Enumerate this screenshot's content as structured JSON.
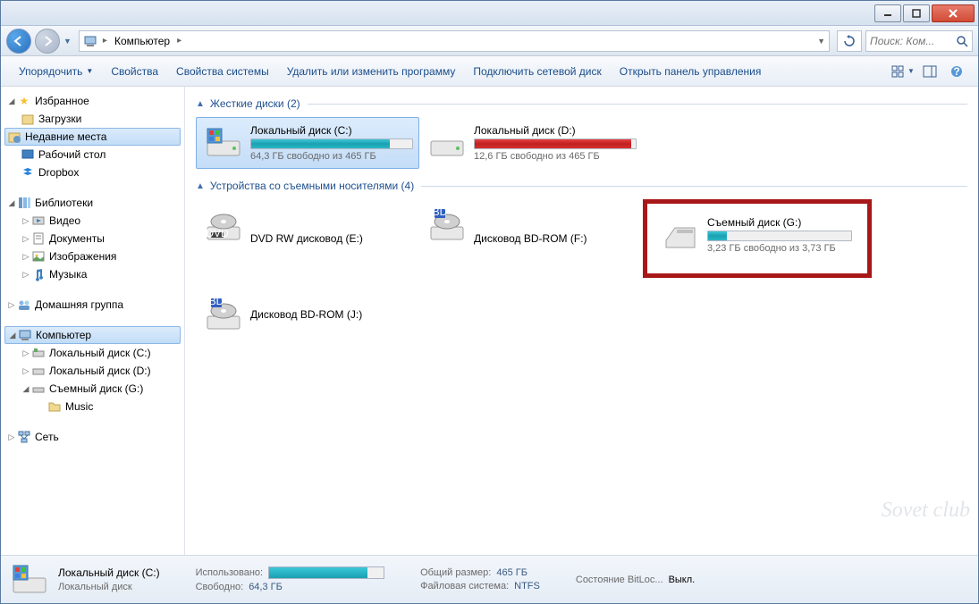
{
  "window": {
    "title": "Компьютер"
  },
  "breadcrumb": {
    "segment1": "Компьютер"
  },
  "search": {
    "placeholder": "Поиск: Ком..."
  },
  "toolbar": {
    "organize": "Упорядочить",
    "properties": "Свойства",
    "system_props": "Свойства системы",
    "uninstall": "Удалить или изменить программу",
    "map_drive": "Подключить сетевой диск",
    "control_panel": "Открыть панель управления"
  },
  "sidebar": {
    "favorites": "Избранное",
    "fav_items": {
      "downloads": "Загрузки",
      "recent": "Недавние места",
      "desktop": "Рабочий стол",
      "dropbox": "Dropbox"
    },
    "libraries": "Библиотеки",
    "lib_items": {
      "video": "Видео",
      "documents": "Документы",
      "images": "Изображения",
      "music": "Музыка"
    },
    "homegroup": "Домашняя группа",
    "computer": "Компьютер",
    "comp_items": {
      "disk_c": "Локальный диск (C:)",
      "disk_d": "Локальный диск (D:)",
      "disk_g": "Съемный диск (G:)",
      "music": "Music"
    },
    "network": "Сеть"
  },
  "content": {
    "group_hdd": "Жесткие диски (2)",
    "group_removable": "Устройства со съемными носителями (4)",
    "drives": {
      "c": {
        "name": "Локальный диск (C:)",
        "free": "64,3 ГБ свободно из 465 ГБ",
        "pct": 86
      },
      "d": {
        "name": "Локальный диск (D:)",
        "free": "12,6 ГБ свободно из 465 ГБ",
        "pct": 97
      },
      "dvd_e": {
        "name": "DVD RW дисковод (E:)"
      },
      "bd_f": {
        "name": "Дисковод BD-ROM (F:)"
      },
      "g": {
        "name": "Съемный диск (G:)",
        "free": "3,23 ГБ свободно из 3,73 ГБ",
        "pct": 13
      },
      "bd_j": {
        "name": "Дисковод BD-ROM (J:)"
      }
    }
  },
  "status": {
    "name": "Локальный диск (C:)",
    "sub": "Локальный диск",
    "used_lbl": "Использовано:",
    "free_lbl": "Свободно:",
    "free_val": "64,3 ГБ",
    "total_lbl": "Общий размер:",
    "total_val": "465 ГБ",
    "fs_lbl": "Файловая система:",
    "fs_val": "NTFS",
    "bitlocker_lbl": "Состояние BitLoc...",
    "bitlocker_val": "Выкл.",
    "bar_pct": 86
  },
  "watermark": "Sovet club"
}
